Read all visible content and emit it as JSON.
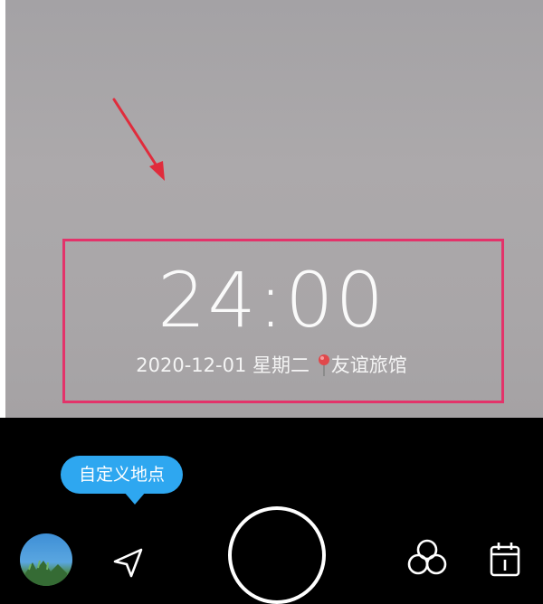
{
  "overlay": {
    "time": "24:00",
    "date": "2020-12-01",
    "weekday": "星期二",
    "location": "友谊旅馆"
  },
  "tooltip": {
    "label": "自定义地点"
  },
  "colors": {
    "highlight_border": "#e3336a",
    "arrow": "#e02c3c",
    "tooltip_bg": "#2ea7f0"
  },
  "icons": {
    "location_pin": "map-pin-icon",
    "navigation": "navigation-arrow-icon",
    "shutter": "shutter-button",
    "filter": "filter-circles-icon",
    "calendar": "calendar-icon"
  }
}
